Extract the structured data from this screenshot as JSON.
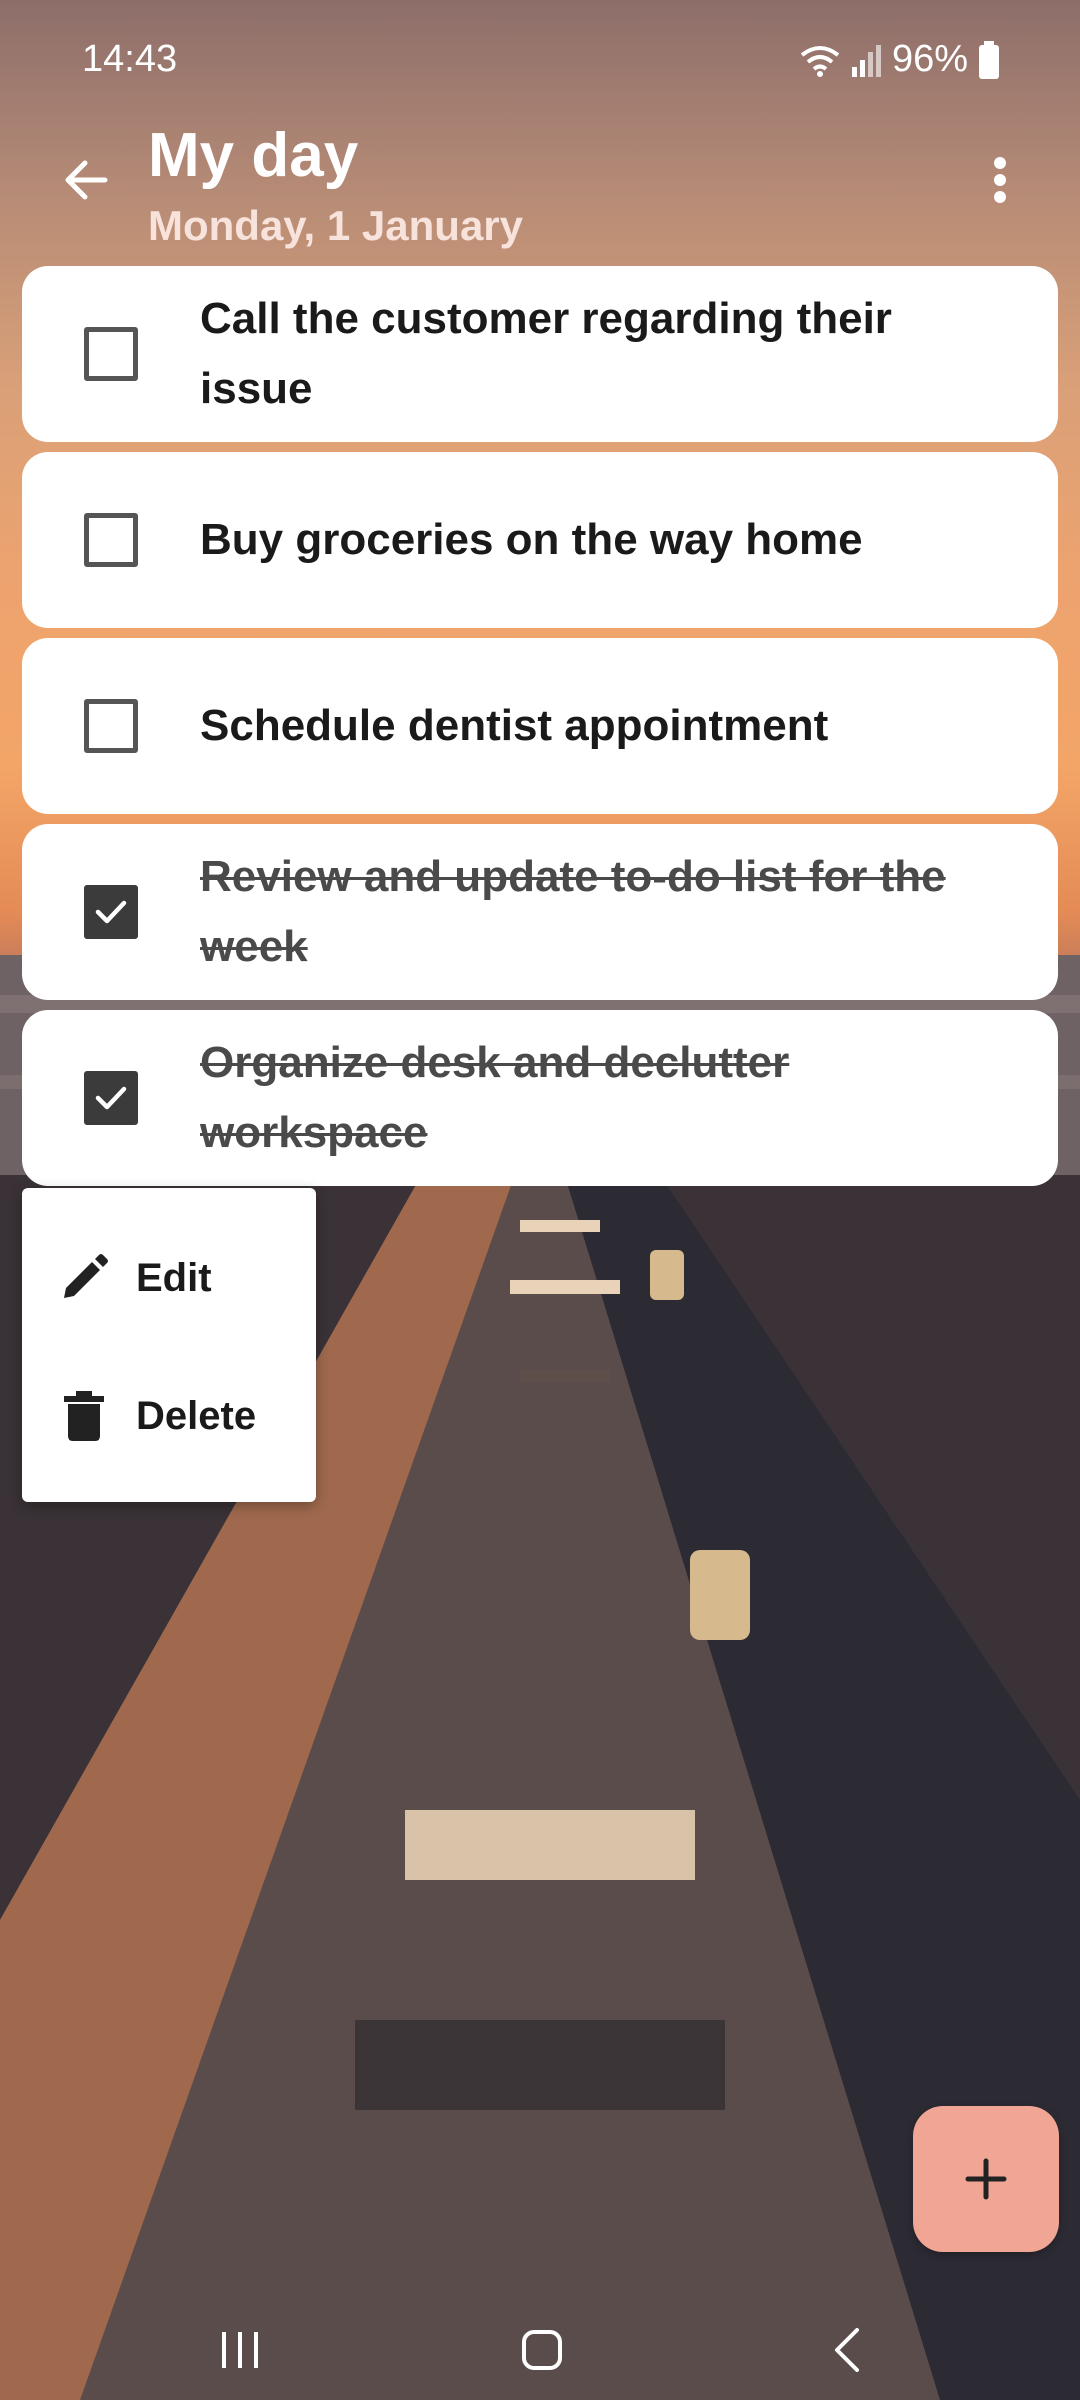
{
  "status_bar": {
    "time": "14:43",
    "battery": "96%"
  },
  "appbar": {
    "title": "My day",
    "subtitle": "Monday, 1 January"
  },
  "tasks": [
    {
      "text": "Call the customer regarding their issue",
      "done": false
    },
    {
      "text": "Buy groceries on the way home",
      "done": false
    },
    {
      "text": "Schedule dentist appointment",
      "done": false
    },
    {
      "text": "Review and update to-do list for the week",
      "done": true
    },
    {
      "text": "Organize desk and declutter workspace",
      "done": true
    }
  ],
  "context_menu": {
    "edit_label": "Edit",
    "delete_label": "Delete"
  },
  "colors": {
    "fab": "#f0a595",
    "card": "#ffffff",
    "checkbox_checked": "#3b3b3b"
  },
  "icons": {
    "back": "arrow-left-icon",
    "more": "more-vert-icon",
    "edit": "pencil-icon",
    "delete": "trash-icon",
    "fab": "plus-icon"
  }
}
